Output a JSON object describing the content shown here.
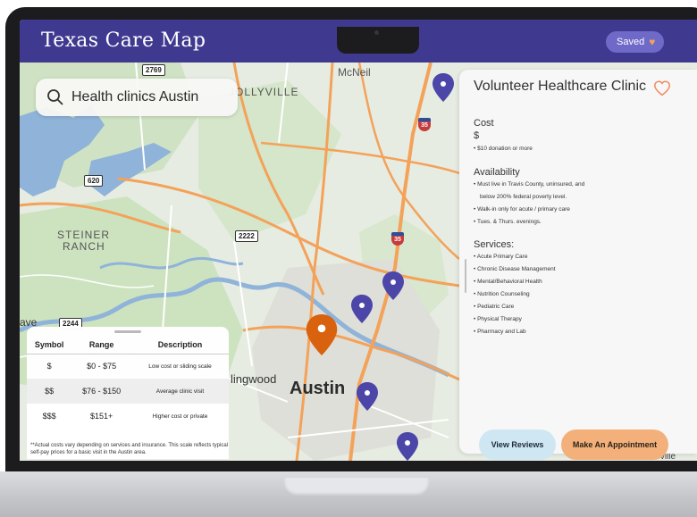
{
  "header": {
    "title": "Texas Care Map",
    "saved_label": "Saved"
  },
  "search": {
    "query": "Health clinics Austin"
  },
  "map": {
    "city": "Austin",
    "places": {
      "mcneil": "McNeil",
      "jollyville": "JOLLYVILLE",
      "steiner": "STEINER",
      "ranch": "RANCH",
      "lingwood": "lingwood",
      "ave": "ave",
      "webberville": "Webberville"
    },
    "roads": {
      "r2769": "2769",
      "r620": "620",
      "r2222": "2222",
      "r2244": "2244",
      "i35": "35"
    }
  },
  "legend": {
    "headers": [
      "Symbol",
      "Range",
      "Description"
    ],
    "rows": [
      {
        "symbol": "$",
        "range": "$0 - $75",
        "description": "Low cost or sliding scale"
      },
      {
        "symbol": "$$",
        "range": "$76 - $150",
        "description": "Average clinic visit"
      },
      {
        "symbol": "$$$",
        "range": "$151+",
        "description": "Higher cost or private"
      }
    ],
    "note": "**Actual costs vary depending on services and insurance. This scale reflects typical self-pay prices for a basic visit in the Austin area."
  },
  "clinic": {
    "name": "Volunteer Healthcare Clinic",
    "cost_title": "Cost",
    "cost_symbol": "$",
    "cost_items": [
      "$10 donation or more"
    ],
    "availability_title": "Availability",
    "availability_items": [
      "Must live in Travis County, uninsured, and",
      "below 200% federal poverty level.",
      "Walk-in only for acute / primary care",
      "Tues. & Thurs. evenings."
    ],
    "services_title": "Services:",
    "services": [
      "Acute Primary Care",
      "Chronic Disease Management",
      "Mental/Behavioral Health",
      "Nutrition Counseling",
      "Pediatric Care",
      "Physical Therapy",
      "Pharmacy and Lab"
    ],
    "view_reviews_label": "View Reviews",
    "appointment_label": "Make An Appointment"
  },
  "colors": {
    "header": "#3f3a8f",
    "pin": "#4b46a8",
    "pin_selected": "#d9620f",
    "appointment": "#f3b07a",
    "reviews": "#cfe7f2"
  }
}
